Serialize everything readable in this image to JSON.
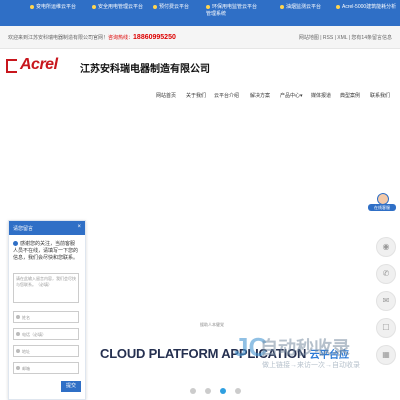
{
  "topbar": {
    "items": [
      {
        "label": "变电所运维云平台"
      },
      {
        "label": "安全用电管理云平台"
      },
      {
        "label": "预付费云平台"
      },
      {
        "label": "环保用电监管云平台",
        "sub": "管理系统"
      },
      {
        "label": "油烟监测云平台"
      },
      {
        "label": "Acrel-5000建筑能耗分析"
      }
    ]
  },
  "infobar": {
    "welcome": "欢迎来到江苏安科瑞电器制造有限公司官网！",
    "hotline_label": "咨询热线：",
    "phone": "18860995250",
    "links": "网站地图 | RSS | XML | 您有14条留言信息"
  },
  "logo": {
    "brand": "Acrel",
    "company": "江苏安科瑞电器制造有限公司"
  },
  "nav": {
    "items": [
      "网站首页",
      "关于我们",
      "云平台介绍",
      "解决方案",
      "产品中心",
      "媒体报道",
      "典型案例",
      "联系我们"
    ]
  },
  "hero": {
    "subtitle": "援助人本健党",
    "title": "CLOUD PLATFORM APPLICATION",
    "title_cn": "云平台应"
  },
  "chat": {
    "title": "请您留言",
    "close": "×",
    "message": "感谢您的关注，当前客服人员不在线，请填写一下您的信息，我们会尽快和您联系。",
    "textarea_placeholder": "请在此输入留言内容，我们会尽快与您联系。（必填）",
    "name_placeholder": "姓名",
    "phone_placeholder": "电话（必填）",
    "address_placeholder": "地址",
    "email_placeholder": "邮箱",
    "submit": "提交"
  },
  "avatar": {
    "label": "在线客服"
  },
  "watermark": {
    "logo": "JC",
    "big": "自动秒收录",
    "small": "做上链接→来访一次→自动收录"
  },
  "slider": {
    "count": 4,
    "active": 3
  }
}
